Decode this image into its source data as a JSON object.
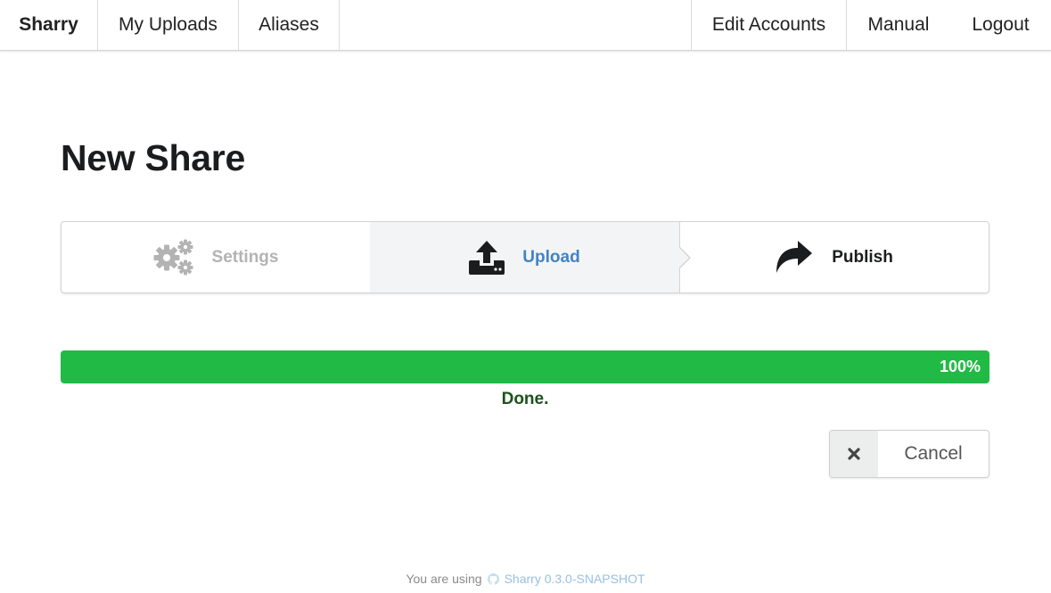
{
  "nav": {
    "brand": "Sharry",
    "my_uploads": "My Uploads",
    "aliases": "Aliases",
    "edit_accounts": "Edit Accounts",
    "manual": "Manual",
    "logout": "Logout"
  },
  "page": {
    "title": "New Share"
  },
  "steps": [
    {
      "label": "Settings",
      "icon": "gears-icon",
      "state": "disabled"
    },
    {
      "label": "Upload",
      "icon": "upload-icon",
      "state": "active"
    },
    {
      "label": "Publish",
      "icon": "share-arrow-icon",
      "state": "normal"
    }
  ],
  "progress": {
    "percent": 100,
    "percent_label": "100%",
    "status": "Done.",
    "color": "#21ba45"
  },
  "cancel_button": {
    "label": "Cancel",
    "icon": "close-icon"
  },
  "footer": {
    "prefix": "You are using",
    "product": "Sharry 0.3.0-SNAPSHOT",
    "icon": "github-icon"
  },
  "colors": {
    "accent": "#4183c4",
    "success": "#21ba45",
    "success_text": "#1a531b"
  }
}
